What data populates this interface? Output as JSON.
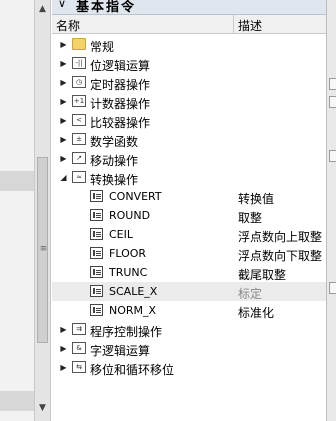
{
  "panel": {
    "title": "基本指令",
    "columns": {
      "name": "名称",
      "description": "描述"
    }
  },
  "tree": [
    {
      "label": "常规",
      "icon": "folder-icon",
      "expanded": false
    },
    {
      "label": "位逻辑运算",
      "icon": "bit-logic-icon",
      "expanded": false
    },
    {
      "label": "定时器操作",
      "icon": "timer-icon",
      "expanded": false
    },
    {
      "label": "计数器操作",
      "icon": "counter-icon",
      "expanded": false
    },
    {
      "label": "比较器操作",
      "icon": "comparator-icon",
      "expanded": false
    },
    {
      "label": "数学函数",
      "icon": "math-icon",
      "expanded": false
    },
    {
      "label": "移动操作",
      "icon": "move-icon",
      "expanded": false
    },
    {
      "label": "转换操作",
      "icon": "convert-icon",
      "expanded": true,
      "children": [
        {
          "name": "CONVERT",
          "description": "转换值"
        },
        {
          "name": "ROUND",
          "description": "取整"
        },
        {
          "name": "CEIL",
          "description": "浮点数向上取整"
        },
        {
          "name": "FLOOR",
          "description": "浮点数向下取整"
        },
        {
          "name": "TRUNC",
          "description": "截尾取整"
        },
        {
          "name": "SCALE_X",
          "description": "标定"
        },
        {
          "name": "NORM_X",
          "description": "标准化"
        }
      ]
    },
    {
      "label": "程序控制操作",
      "icon": "program-control-icon",
      "expanded": false
    },
    {
      "label": "字逻辑运算",
      "icon": "word-logic-icon",
      "expanded": false
    },
    {
      "label": "移位和循环移位",
      "icon": "shift-rotate-icon",
      "expanded": false
    }
  ]
}
